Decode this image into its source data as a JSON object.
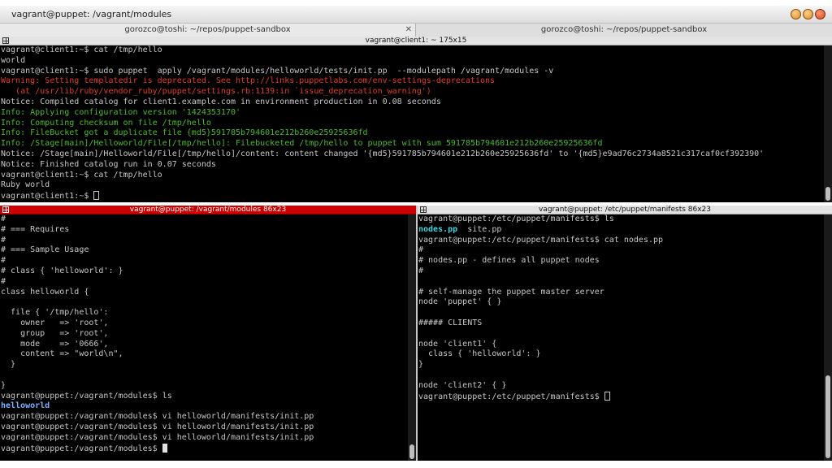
{
  "window": {
    "title": "vagrant@puppet: /vagrant/modules"
  },
  "tabs": [
    {
      "label": "gorozco@toshi: ~/repos/puppet-sandbox",
      "close": "✕"
    },
    {
      "label": "gorozco@toshi: ~/repos/puppet-sandbox"
    }
  ],
  "top_pane": {
    "header": "vagrant@client1: ~ 175x15",
    "lines": [
      {
        "text": "vagrant@client1:~$ cat /tmp/hello",
        "color": "default"
      },
      {
        "text": "world",
        "color": "default"
      },
      {
        "text": "vagrant@client1:~$ sudo puppet  apply /vagrant/modules/helloworld/tests/init.pp  --modulepath /vagrant/modules -v",
        "color": "default"
      },
      {
        "text": "Warning: Setting templatedir is deprecated. See http://links.puppetlabs.com/env-settings-deprecations",
        "color": "red"
      },
      {
        "text": "   (at /usr/lib/ruby/vendor_ruby/puppet/settings.rb:1139:in `issue_deprecation_warning')",
        "color": "red"
      },
      {
        "text": "Notice: Compiled catalog for client1.example.com in environment production in 0.08 seconds",
        "color": "default"
      },
      {
        "text": "Info: Applying configuration version '1424353170'",
        "color": "green"
      },
      {
        "text": "Info: Computing checksum on file /tmp/hello",
        "color": "green"
      },
      {
        "text": "Info: FileBucket got a duplicate file {md5}591785b794601e212b260e25925636fd",
        "color": "green"
      },
      {
        "text": "Info: /Stage[main]/Helloworld/File[/tmp/hello]: Filebucketed /tmp/hello to puppet with sum 591785b794601e212b260e25925636fd",
        "color": "green"
      },
      {
        "text": "Notice: /Stage[main]/Helloworld/File[/tmp/hello]/content: content changed '{md5}591785b794601e212b260e25925636fd' to '{md5}e9ad76c2734a8521c317caf0cf392390'",
        "color": "default"
      },
      {
        "text": "Notice: Finished catalog run in 0.07 seconds",
        "color": "default"
      },
      {
        "text": "vagrant@client1:~$ cat /tmp/hello",
        "color": "default"
      },
      {
        "text": "Ruby world",
        "color": "default"
      },
      {
        "text": "vagrant@client1:~$ ",
        "color": "default"
      }
    ]
  },
  "left_pane": {
    "header": "vagrant@puppet: /vagrant/modules 86x23",
    "lines": [
      {
        "text": "#",
        "color": "default"
      },
      {
        "text": "# === Requires",
        "color": "default"
      },
      {
        "text": "#",
        "color": "default"
      },
      {
        "text": "# === Sample Usage",
        "color": "default"
      },
      {
        "text": "#",
        "color": "default"
      },
      {
        "text": "# class { 'helloworld': }",
        "color": "default"
      },
      {
        "text": "#",
        "color": "default"
      },
      {
        "text": "class helloworld {",
        "color": "default"
      },
      {
        "text": "",
        "color": "default"
      },
      {
        "text": "  file { '/tmp/hello':",
        "color": "default"
      },
      {
        "text": "    owner   => 'root',",
        "color": "default"
      },
      {
        "text": "    group   => 'root',",
        "color": "default"
      },
      {
        "text": "    mode    => '0666',",
        "color": "default"
      },
      {
        "text": "    content => \"world\\n\",",
        "color": "default"
      },
      {
        "text": "  }",
        "color": "default"
      },
      {
        "text": "",
        "color": "default"
      },
      {
        "text": "}",
        "color": "default"
      },
      {
        "text": "vagrant@puppet:/vagrant/modules$ ls",
        "color": "default"
      },
      {
        "text": "helloworld",
        "color": "blue"
      },
      {
        "text": "vagrant@puppet:/vagrant/modules$ vi helloworld/manifests/init.pp",
        "color": "default"
      },
      {
        "text": "vagrant@puppet:/vagrant/modules$ vi helloworld/manifests/init.pp",
        "color": "default"
      },
      {
        "text": "vagrant@puppet:/vagrant/modules$ vi helloworld/manifests/init.pp",
        "color": "default"
      },
      {
        "text": "vagrant@puppet:/vagrant/modules$ ",
        "color": "default"
      }
    ]
  },
  "right_pane": {
    "header": "vagrant@puppet: /etc/puppet/manifests 86x23",
    "ls_files": [
      "nodes.pp",
      "site.pp"
    ],
    "lines": [
      {
        "text": "vagrant@puppet:/etc/puppet/manifests$ ls",
        "color": "default"
      },
      {
        "text": "",
        "color": "default"
      },
      {
        "text": "vagrant@puppet:/etc/puppet/manifests$ cat nodes.pp",
        "color": "default"
      },
      {
        "text": "#",
        "color": "default"
      },
      {
        "text": "# nodes.pp - defines all puppet nodes",
        "color": "default"
      },
      {
        "text": "#",
        "color": "default"
      },
      {
        "text": "",
        "color": "default"
      },
      {
        "text": "# self-manage the puppet master server",
        "color": "default"
      },
      {
        "text": "node 'puppet' { }",
        "color": "default"
      },
      {
        "text": "",
        "color": "default"
      },
      {
        "text": "##### CLIENTS",
        "color": "default"
      },
      {
        "text": "",
        "color": "default"
      },
      {
        "text": "node 'client1' {",
        "color": "default"
      },
      {
        "text": "  class { 'helloworld': }",
        "color": "default"
      },
      {
        "text": "}",
        "color": "default"
      },
      {
        "text": "",
        "color": "default"
      },
      {
        "text": "node 'client2' { }",
        "color": "default"
      },
      {
        "text": "vagrant@puppet:/etc/puppet/manifests$ ",
        "color": "default"
      }
    ]
  }
}
